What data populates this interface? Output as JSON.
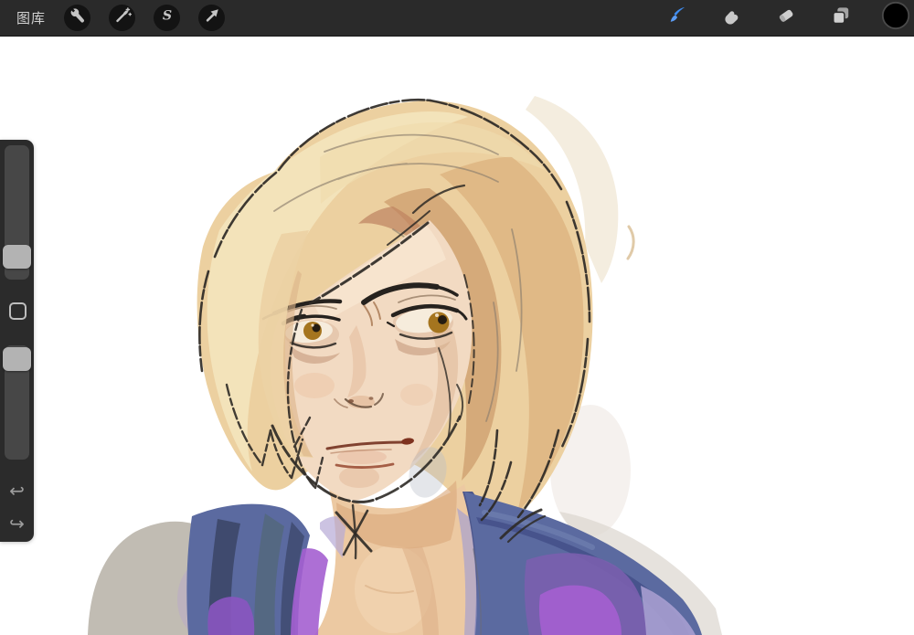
{
  "topbar": {
    "background": "#2a2a2a",
    "gallery_label": "图库",
    "left_tools": [
      {
        "id": "actions",
        "icon": "wrench-icon"
      },
      {
        "id": "adjustments",
        "icon": "magic-wand-icon",
        "glyph": ""
      },
      {
        "id": "selection",
        "icon": "selection-s-icon",
        "glyph": "S"
      },
      {
        "id": "transform",
        "icon": "move-arrow-icon"
      }
    ],
    "right_tools": [
      {
        "id": "paint",
        "icon": "paintbrush-icon",
        "active": true,
        "accent": "#3f8df2"
      },
      {
        "id": "smudge",
        "icon": "smudge-finger-icon",
        "active": false
      },
      {
        "id": "erase",
        "icon": "eraser-icon",
        "active": false
      },
      {
        "id": "layers",
        "icon": "layers-icon",
        "active": false
      },
      {
        "id": "color",
        "icon": "color-swatch-icon",
        "current_color": "#000000"
      }
    ]
  },
  "sidebar": {
    "background": "#2b2b2b",
    "size_slider": {
      "name": "brush-size",
      "handle_position_fraction": 0.78
    },
    "modify_button": {
      "shape": "square-outline"
    },
    "opacity_slider": {
      "name": "brush-opacity",
      "handle_position_fraction": 0.02
    },
    "undo_glyph": "↩",
    "redo_glyph": "↪"
  },
  "canvas": {
    "background": "#ffffff",
    "artwork": {
      "description": "Watercolor-style digital portrait of a woman with chin-length blonde hair, hazel eyes glancing to her left, wearing a blue and purple coat",
      "palette": {
        "hair_base": "#ecd0a0",
        "hair_light": "#f4e4bc",
        "hair_shade": "#dcb27d",
        "hair_deep": "#c69160",
        "skin_base": "#f2dac2",
        "skin_chest": "#ecc9a2",
        "line": "#2e2a26",
        "iris": "#a5751f",
        "lip": "#7a3a28",
        "coat_slate": "#5b6aa0",
        "coat_navy": "#45518a",
        "coat_dark": "#3c4768",
        "coat_purple": "#8a55c0",
        "coat_purple_bright": "#a45fd0",
        "coat_lavender": "#a79fd0",
        "shadow_gray": "#b6b0a6"
      }
    }
  }
}
